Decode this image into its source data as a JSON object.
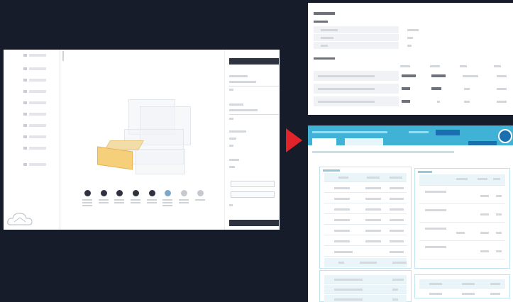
{
  "colors": {
    "background": "#161c29",
    "arrow": "#e0242a",
    "accent": "#3fb2d6",
    "dark": "#2f3340",
    "selected_box": "#f6cf7a"
  },
  "left_app": {
    "sidebar": {
      "item_count": 12
    },
    "thumbnails": {
      "count": 8
    }
  },
  "arrow": {
    "icon": "triangle-right-icon"
  },
  "top_right_doc": {
    "rows_section1": 3,
    "rows_section2": 3
  },
  "bottom_right_app": {
    "header_icon": "user-avatar-icon"
  }
}
